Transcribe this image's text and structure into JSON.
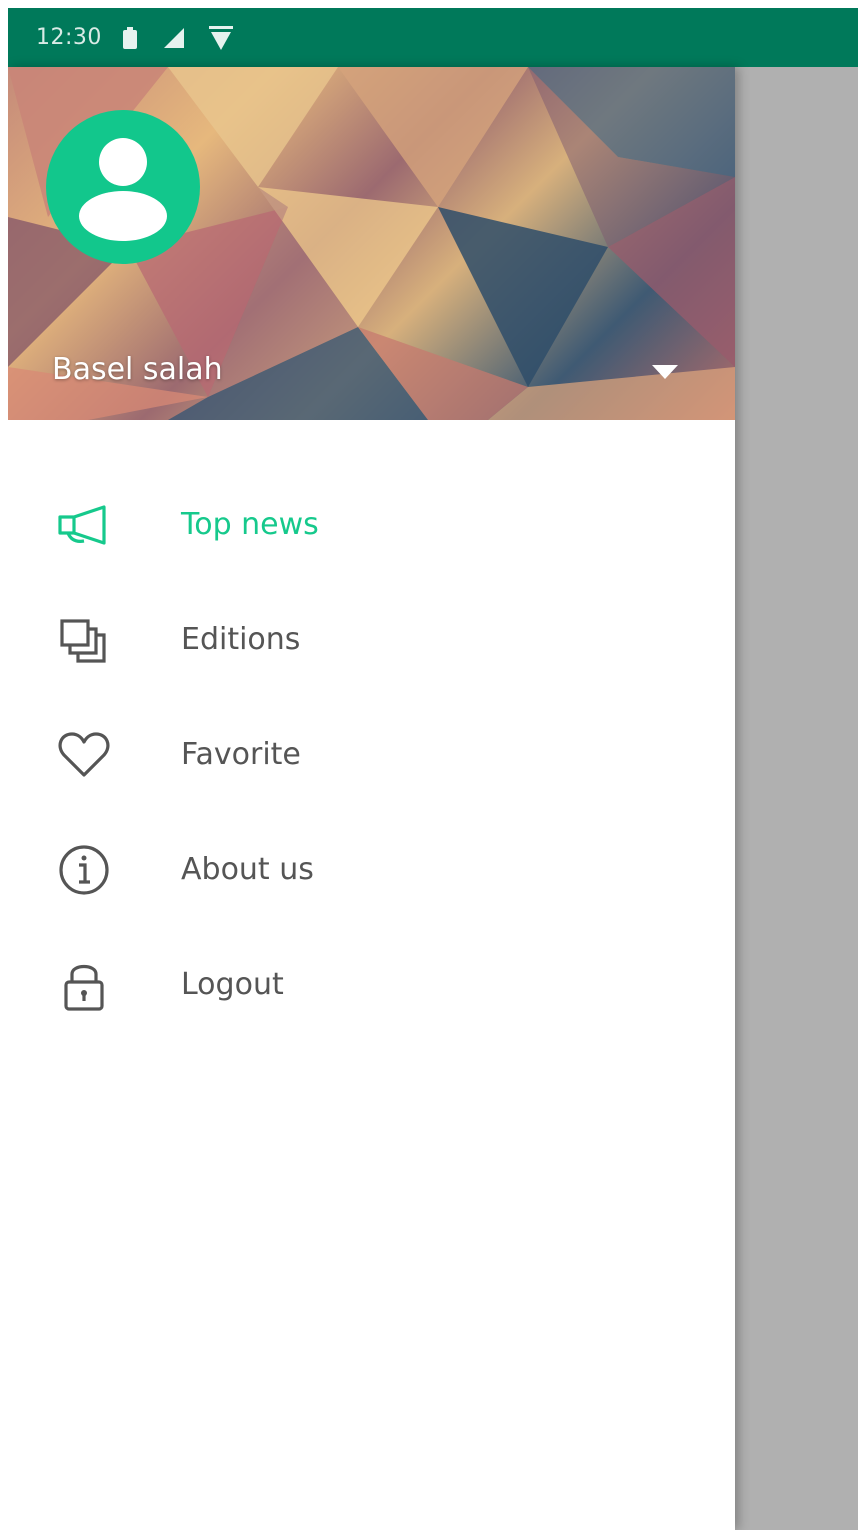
{
  "status_bar": {
    "time": "12:30",
    "icons": [
      "battery-icon",
      "signal-icon",
      "wifi-icon"
    ]
  },
  "drawer": {
    "header": {
      "user_name": "Basel salah",
      "avatar_icon": "user-avatar-icon",
      "toggle_icon": "dropdown-arrow-icon"
    },
    "menu": [
      {
        "label": "Top  news",
        "icon": "megaphone-icon",
        "active": true
      },
      {
        "label": "Editions",
        "icon": "editions-icon",
        "active": false
      },
      {
        "label": "Favorite",
        "icon": "heart-icon",
        "active": false
      },
      {
        "label": "About us",
        "icon": "info-icon",
        "active": false
      },
      {
        "label": "Logout",
        "icon": "lock-icon",
        "active": false
      }
    ]
  },
  "colors": {
    "status_bar": "#00795a",
    "accent": "#16c98c",
    "avatar": "#12c78c",
    "text": "#555555",
    "scrim": "#b0b0b0"
  }
}
